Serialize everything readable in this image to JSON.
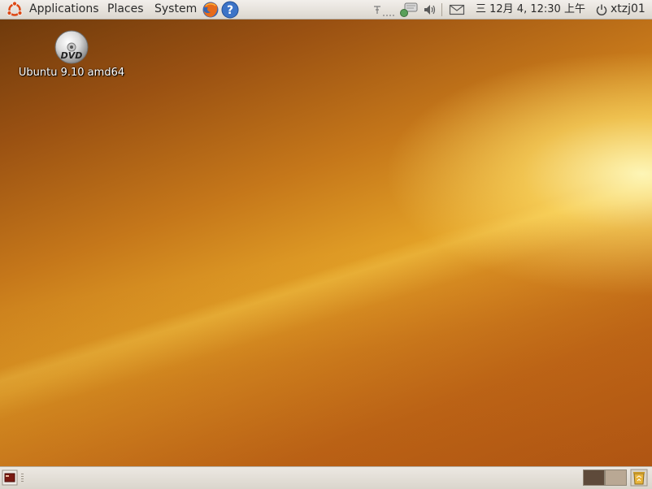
{
  "top_panel": {
    "menus": {
      "applications": "Applications",
      "places": "Places",
      "system": "System"
    },
    "launchers": [
      "firefox-icon",
      "help-icon"
    ],
    "tray_icons": [
      "network-icon",
      "update-notifier-icon",
      "volume-icon",
      "mail-icon"
    ],
    "clock": "三 12月  4, 12:30 上午",
    "user": "xtzj01"
  },
  "desktop": {
    "icons": [
      {
        "label": "Ubuntu 9.10 amd64",
        "icon": "dvd-icon"
      }
    ]
  },
  "bottom_panel": {
    "workspaces": 2,
    "active_workspace": 1,
    "widgets": [
      "show-desktop-icon",
      "trash-icon"
    ]
  },
  "colors": {
    "panel": "#e6e2db",
    "accent": "#dd4814"
  }
}
